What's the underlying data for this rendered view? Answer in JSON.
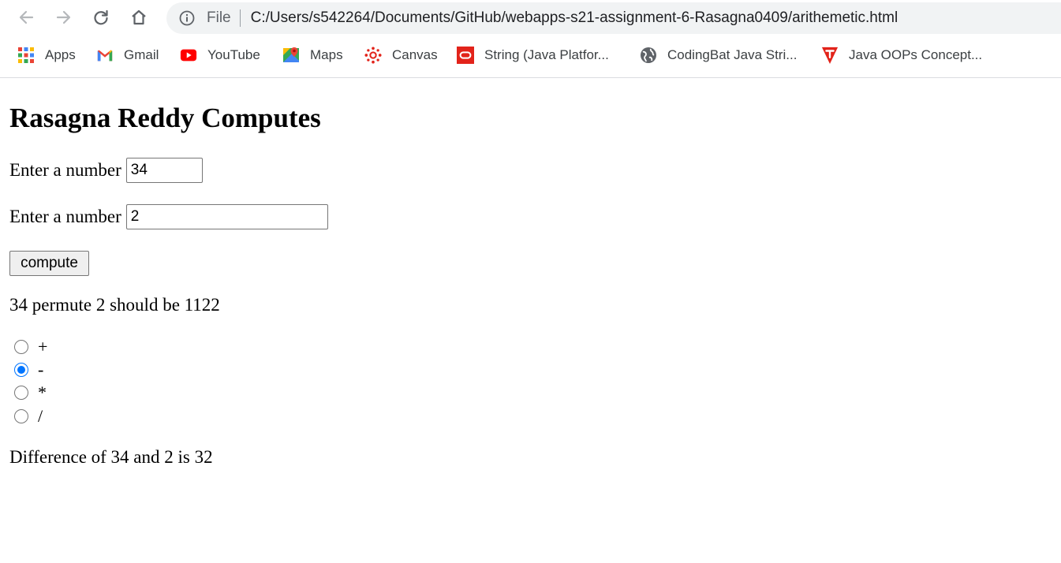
{
  "browser": {
    "address_scheme": "File",
    "url": "C:/Users/s542264/Documents/GitHub/webapps-s21-assignment-6-Rasagna0409/arithemetic.html",
    "bookmarks": [
      {
        "label": "Apps",
        "icon": "apps-grid-icon"
      },
      {
        "label": "Gmail",
        "icon": "gmail-icon"
      },
      {
        "label": "YouTube",
        "icon": "youtube-icon"
      },
      {
        "label": "Maps",
        "icon": "maps-icon"
      },
      {
        "label": "Canvas",
        "icon": "canvas-icon"
      },
      {
        "label": "String (Java Platfor...",
        "icon": "oracle-icon"
      },
      {
        "label": "CodingBat Java Stri...",
        "icon": "globe-icon"
      },
      {
        "label": "Java OOPs Concept...",
        "icon": "javatpoint-icon"
      }
    ]
  },
  "page": {
    "title": "Rasagna Reddy Computes",
    "first_label": "Enter a number",
    "first_value": "34",
    "second_label": "Enter a number",
    "second_value": "2",
    "compute_label": "compute",
    "permute_result": "34 permute 2 should be 1122",
    "operations": [
      {
        "symbol": "+",
        "checked": false
      },
      {
        "symbol": "-",
        "checked": true
      },
      {
        "symbol": "*",
        "checked": false
      },
      {
        "symbol": "/",
        "checked": false
      }
    ],
    "result": "Difference of 34 and 2 is 32"
  },
  "colors": {
    "radio_accent": "#0075ff",
    "omnibox_bg": "#f1f3f4"
  }
}
